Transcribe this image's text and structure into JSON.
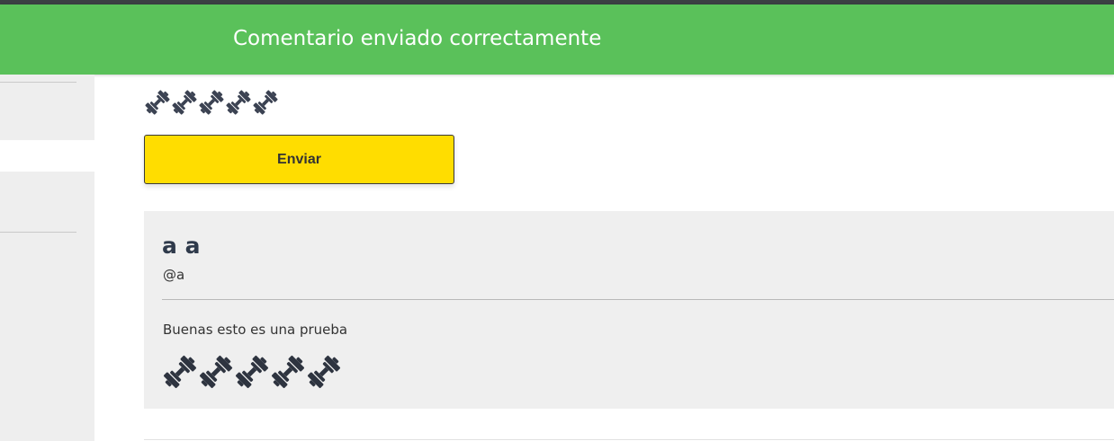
{
  "toast": {
    "message": "Comentario enviado correctamente"
  },
  "rating_input": {
    "icon": "dumbbell-icon",
    "value": 5,
    "max": 5,
    "color": "#3b4252"
  },
  "send_button": {
    "label": "Enviar"
  },
  "comment": {
    "name": "a a",
    "handle": "@a",
    "text": "Buenas esto es una prueba",
    "rating": {
      "icon": "dumbbell-icon",
      "value": 5,
      "max": 5,
      "color": "#2e3440"
    }
  },
  "colors": {
    "toast_bg": "#5ac15a",
    "button_bg": "#ffdd00",
    "card_bg": "#efefef",
    "sidebar_bg": "#eeeeee"
  }
}
